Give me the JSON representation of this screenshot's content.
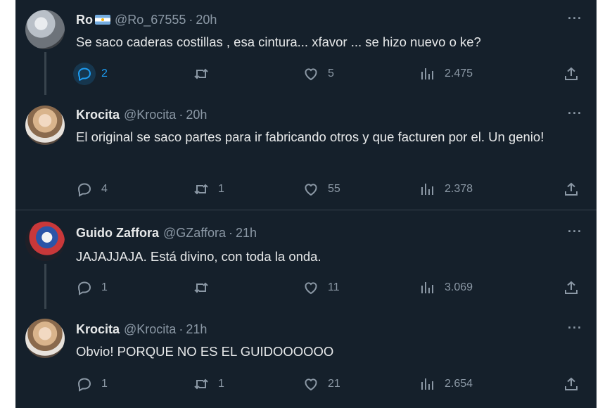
{
  "tweets": [
    {
      "name": "Ro",
      "handle": "@Ro_67555",
      "separator": "·",
      "time": "20h",
      "text": "Se saco caderas costillas , esa cintura... xfavor ... se hizo nuevo o ke?",
      "more": "···",
      "replies": "2",
      "retweets": "",
      "likes": "5",
      "views": "2.475"
    },
    {
      "name": "Krocita",
      "handle": "@Krocita",
      "separator": "·",
      "time": "20h",
      "text": "El original se saco partes para ir fabricando otros y que facturen por el. Un genio!",
      "more": "···",
      "replies": "4",
      "retweets": "1",
      "likes": "55",
      "views": "2.378"
    },
    {
      "name": "Guido Zaffora",
      "handle": "@GZaffora",
      "separator": "·",
      "time": "21h",
      "text": "JAJAJJAJA. Está divino, con toda la onda.",
      "more": "···",
      "replies": "1",
      "retweets": "",
      "likes": "11",
      "views": "3.069"
    },
    {
      "name": "Krocita",
      "handle": "@Krocita",
      "separator": "·",
      "time": "21h",
      "text": "Obvio! PORQUE NO ES EL GUIDOOOOOO",
      "more": "···",
      "replies": "1",
      "retweets": "1",
      "likes": "21",
      "views": "2.654"
    }
  ],
  "icons": {
    "reply": "reply-icon",
    "retweet": "retweet-icon",
    "like": "heart-icon",
    "views": "views-icon",
    "share": "share-icon",
    "flag": "argentina-flag-icon"
  },
  "colors": {
    "background": "#15202b",
    "text": "#e7e9ea",
    "secondary": "#8b98a5",
    "accent": "#1d9bf0",
    "border": "#38444d"
  }
}
